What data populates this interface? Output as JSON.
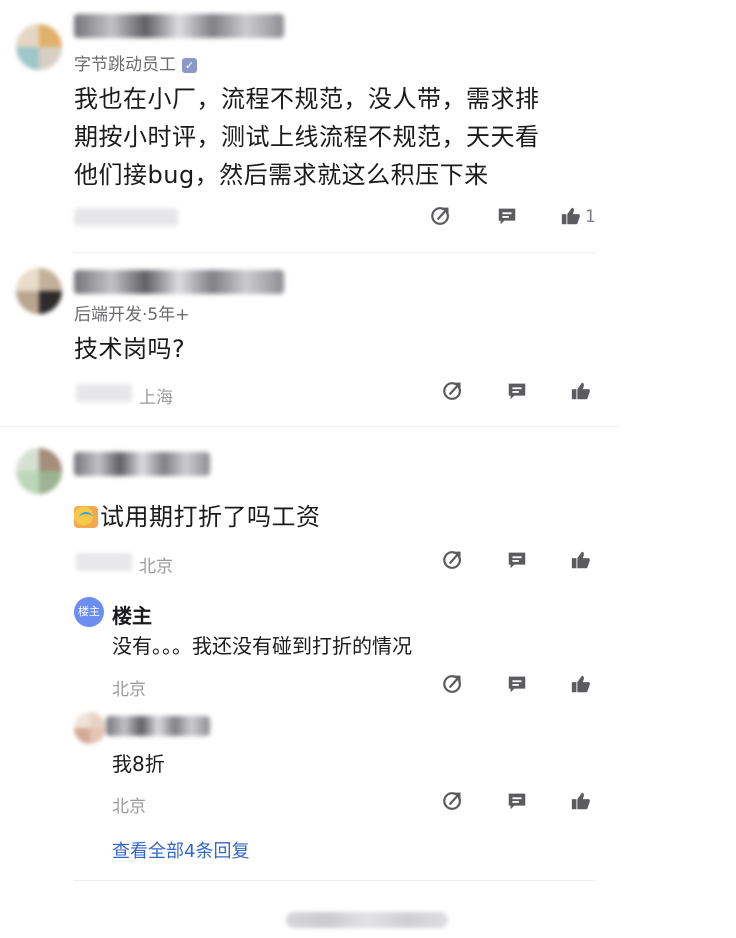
{
  "colors": {
    "link": "#3467c8",
    "op_badge": "#6b8ef0",
    "icon": "#5b5b60",
    "meta": "#9a9aa0"
  },
  "comments": [
    {
      "subtitle": "字节跳动员工",
      "verified_icon": "verified-icon",
      "text_lines": [
        "我也在小厂，流程不规范，没人带，需求排",
        "期按小时评，测试上线流程不规范，天天看",
        "他们接bug，然后需求就这么积压下来"
      ],
      "location": "",
      "like_count": "1"
    },
    {
      "subtitle": "后端开发·5年+",
      "text_lines": [
        "技术岗吗?"
      ],
      "location": "上海",
      "like_count": ""
    },
    {
      "subtitle": "",
      "text": "试用期打折了吗工资",
      "location": "北京",
      "like_count": "",
      "replies": [
        {
          "badge": "楼主",
          "name": "楼主",
          "text": "没有。。。我还没有碰到打折的情况",
          "location": "北京"
        },
        {
          "text": "我8折",
          "location": "北京"
        }
      ],
      "view_all_label": "查看全部4条回复"
    }
  ],
  "icons": {
    "share": "share-icon",
    "comment": "comment-icon",
    "like": "thumbs-up-icon"
  }
}
